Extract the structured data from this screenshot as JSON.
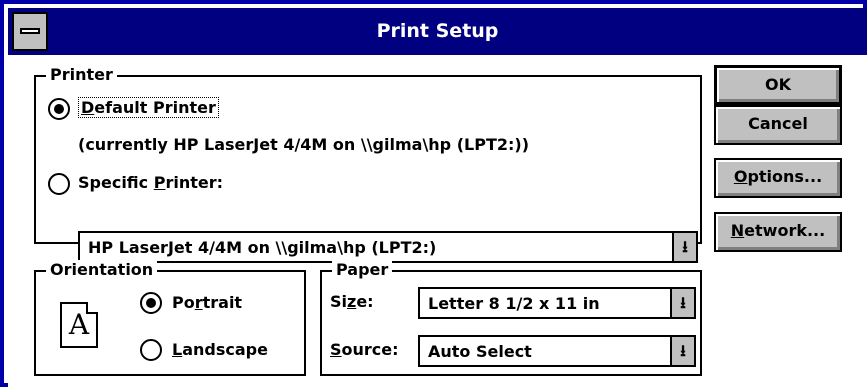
{
  "window": {
    "title": "Print Setup"
  },
  "printer_group": {
    "label": "Printer",
    "default_label_before": "",
    "default_label_u": "D",
    "default_label_after": "efault Printer",
    "default_selected": true,
    "current": "(currently HP LaserJet 4/4M on \\\\gilma\\hp (LPT2:))",
    "specific_label_before": "Specific ",
    "specific_label_u": "P",
    "specific_label_after": "rinter:",
    "specific_selected": false,
    "specific_value": "HP LaserJet 4/4M on \\\\gilma\\hp (LPT2:)"
  },
  "orientation_group": {
    "label": "Orientation",
    "icon_letter": "A",
    "portrait_before": "Po",
    "portrait_u": "r",
    "portrait_after": "trait",
    "portrait_selected": true,
    "landscape_before": "",
    "landscape_u": "L",
    "landscape_after": "andscape",
    "landscape_selected": false
  },
  "paper_group": {
    "label": "Paper",
    "size_label_before": "Si",
    "size_label_u": "z",
    "size_label_after": "e:",
    "size_value": "Letter 8 1/2 x 11 in",
    "source_label_before": "",
    "source_label_u": "S",
    "source_label_after": "ource:",
    "source_value": "Auto Select"
  },
  "buttons": {
    "ok": "OK",
    "cancel": "Cancel",
    "options_u": "O",
    "options_after": "ptions...",
    "network_before": "",
    "network_u": "N",
    "network_after": "etwork..."
  },
  "colors": {
    "titlebar": "#000080",
    "button_face": "#c0c0c0"
  },
  "icons": {
    "system_menu": "system-menu-icon",
    "dropdown": "down-arrow-icon",
    "portrait_page": "portrait-page-icon"
  }
}
